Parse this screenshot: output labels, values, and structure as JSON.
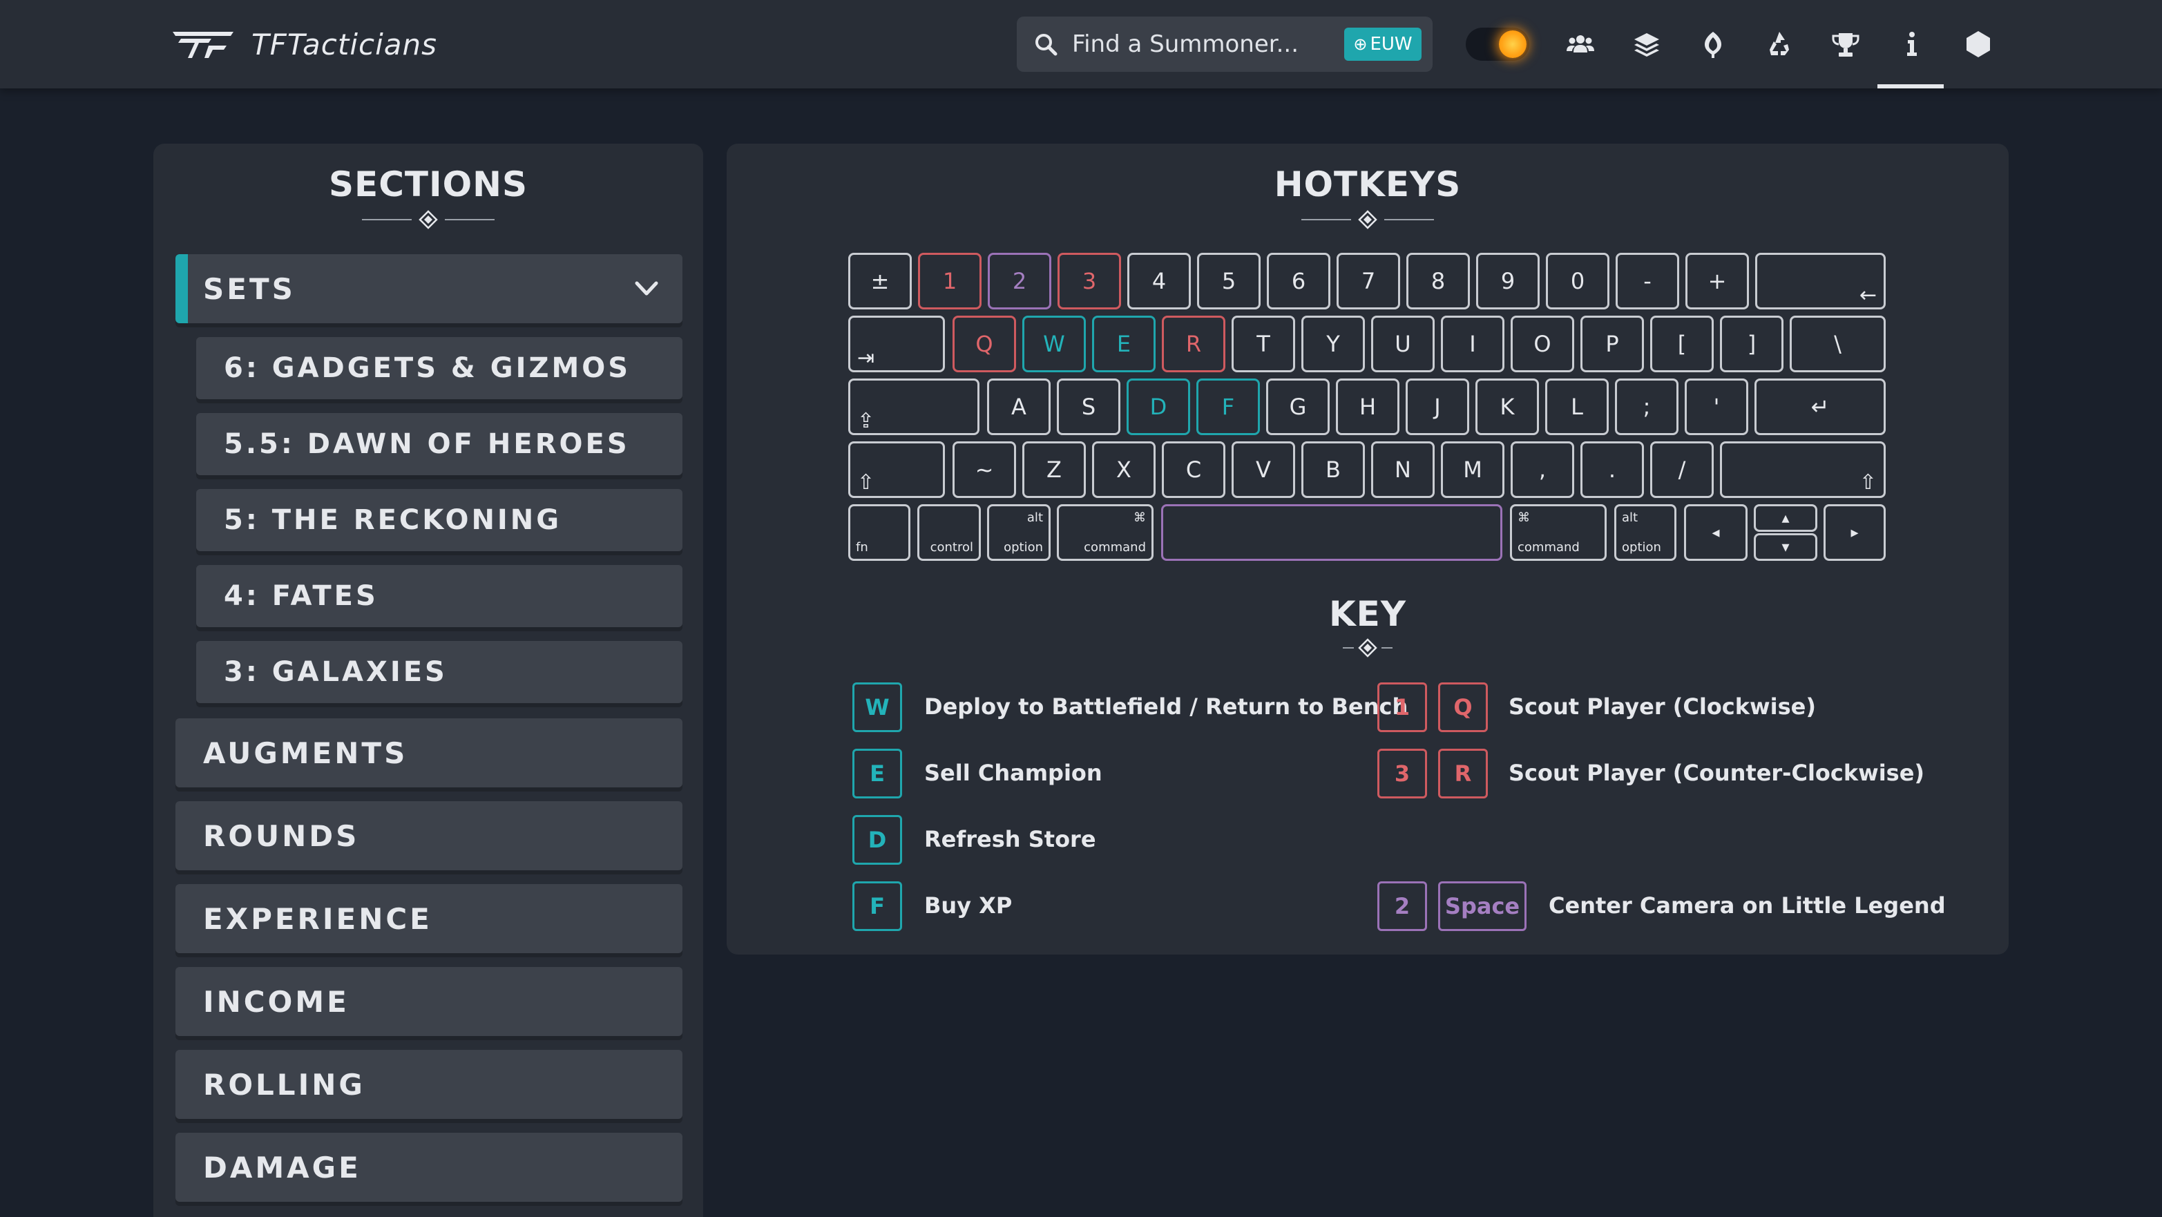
{
  "header": {
    "brand_name": "TFTacticians",
    "search_placeholder": "Find a Summoner...",
    "region": "EUW",
    "nav_icons": [
      "users-icon",
      "layers-icon",
      "champions-icon",
      "recycle-icon",
      "trophy-icon",
      "info-icon",
      "hexagon-icon"
    ],
    "active_nav": "info-icon",
    "accent_color": "#1fa6ad"
  },
  "sections": {
    "title": "SECTIONS",
    "items": [
      {
        "label": "SETS",
        "active": true,
        "expanded": true,
        "children": [
          "6: GADGETS & GIZMOS",
          "5.5: DAWN OF HEROES",
          "5: THE RECKONING",
          "4: FATES",
          "3: GALAXIES"
        ]
      },
      {
        "label": "AUGMENTS"
      },
      {
        "label": "ROUNDS"
      },
      {
        "label": "EXPERIENCE"
      },
      {
        "label": "INCOME"
      },
      {
        "label": "ROLLING"
      },
      {
        "label": "DAMAGE"
      }
    ]
  },
  "hotkeys": {
    "title": "HOTKEYS",
    "keyboard": {
      "row1": [
        "±",
        "1",
        "2",
        "3",
        "4",
        "5",
        "6",
        "7",
        "8",
        "9",
        "0",
        "-",
        "+",
        "←"
      ],
      "row2": [
        "⇥",
        "Q",
        "W",
        "E",
        "R",
        "T",
        "Y",
        "U",
        "I",
        "O",
        "P",
        "[",
        "]",
        "\\"
      ],
      "row3": [
        "⇪",
        "A",
        "S",
        "D",
        "F",
        "G",
        "H",
        "J",
        "K",
        "L",
        ";",
        "'",
        "↵"
      ],
      "row4": [
        "⇧",
        "~",
        "Z",
        "X",
        "C",
        "V",
        "B",
        "N",
        "M",
        ",",
        ".",
        "/",
        "⇧"
      ],
      "row5": {
        "fn": "fn",
        "control": "control",
        "alt": "alt",
        "option": "option",
        "cmd_symbol": "⌘",
        "command": "command",
        "left": "◂",
        "up": "▴",
        "down": "▾",
        "right": "▸"
      }
    },
    "key_title": "KEY",
    "legend_left": [
      {
        "keys": [
          "W"
        ],
        "label": "Deploy to Battlefield / Return to Bench"
      },
      {
        "keys": [
          "E"
        ],
        "label": "Sell Champion"
      },
      {
        "keys": [
          "D"
        ],
        "label": "Refresh Store"
      },
      {
        "keys": [
          "F"
        ],
        "label": "Buy XP"
      }
    ],
    "legend_right": [
      {
        "keys": [
          "1",
          "Q"
        ],
        "label": "Scout Player (Clockwise)"
      },
      {
        "keys": [
          "3",
          "R"
        ],
        "label": "Scout Player (Counter-Clockwise)"
      },
      {
        "keys": [
          "2",
          "Space"
        ],
        "label": "Center Camera on Little Legend"
      }
    ],
    "colors": {
      "teal": "#1fa6ad",
      "red": "#cf5a5f",
      "purple": "#9b72b7"
    }
  }
}
